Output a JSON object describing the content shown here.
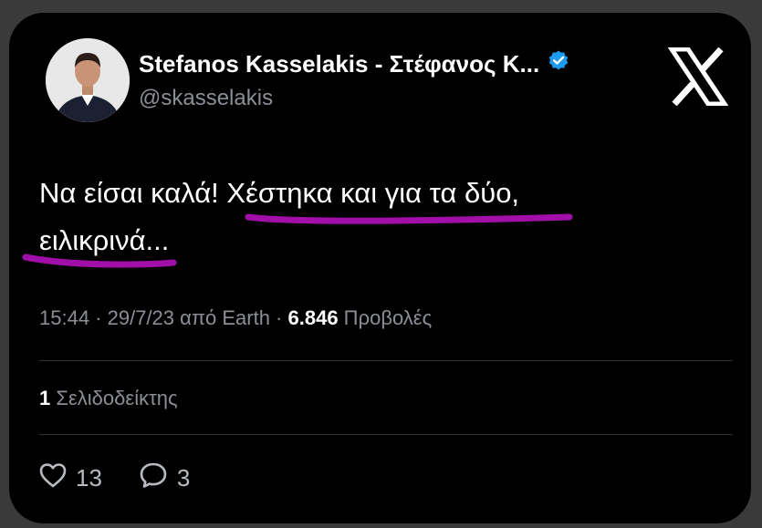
{
  "author": {
    "display_name": "Stefanos Kasselakis - Στέφανος Κ...",
    "handle": "@skasselakis",
    "verified": true
  },
  "brand_icon": "x-logo-icon",
  "tweet": {
    "line1": "Να είσαι καλά! Χέστηκα και για τα δύο,",
    "line2": "ειλικρινά..."
  },
  "meta": {
    "time_date": "15:44 · 29/7/23 από Earth · ",
    "views_count": "6.846",
    "views_label": " Προβολές"
  },
  "bookmarks": {
    "count": "1",
    "label": " Σελιδοδείκτης"
  },
  "actions": {
    "likes": "13",
    "replies": "3"
  },
  "colors": {
    "highlight": "#a10fa8",
    "verified_badge": "#1d9bf0",
    "muted_text": "#8b8f95"
  }
}
